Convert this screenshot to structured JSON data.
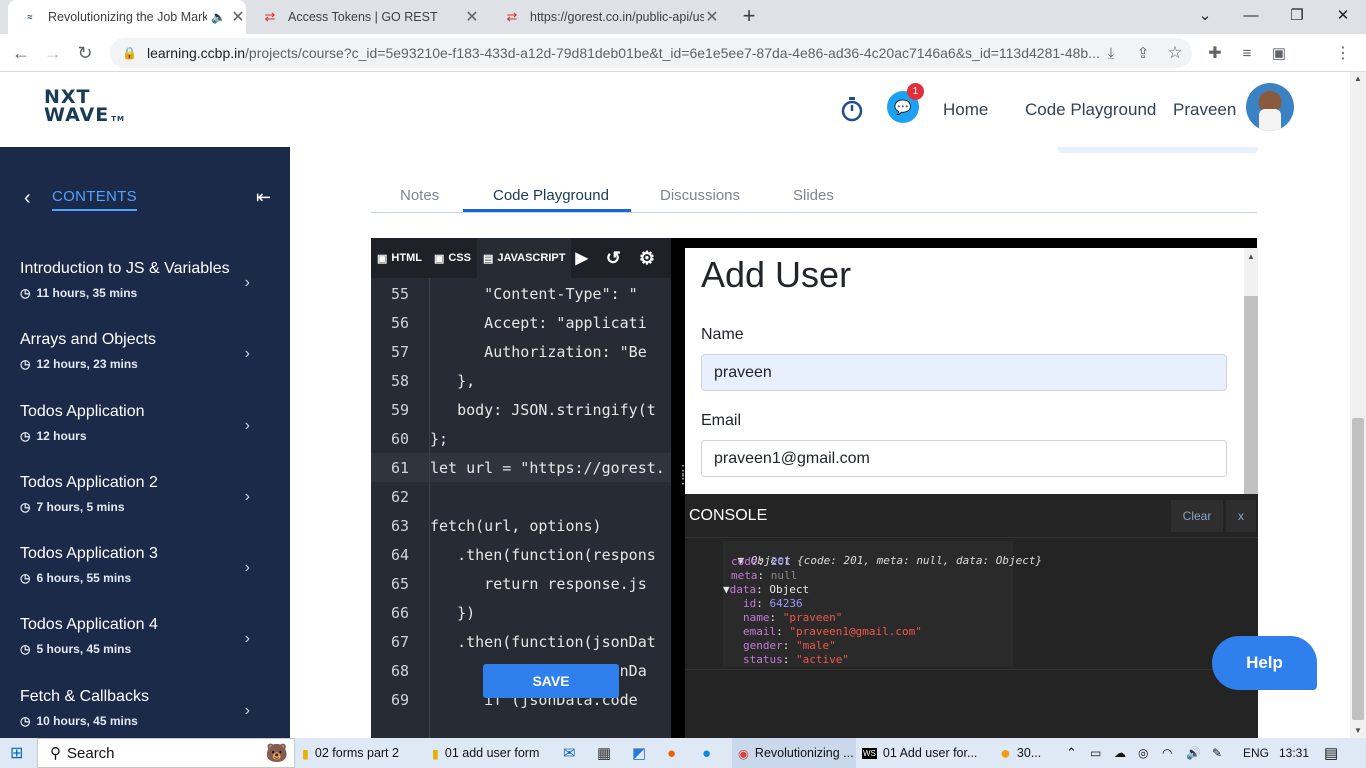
{
  "browser": {
    "tabs": [
      {
        "title": "Revolutionizing the Job Mark",
        "active": true
      },
      {
        "title": "Access Tokens | GO REST",
        "active": false
      },
      {
        "title": "https://gorest.co.in/public-api/us",
        "active": false
      }
    ],
    "new_tab": "+",
    "url_domain": "learning.ccbp.in",
    "url_path": "/projects/course?c_id=5e93210e-f183-433d-a12d-79d81deb01be&t_id=6e1e5ee7-87da-4e86-ad36-4c20ac7146a6&s_id=113d4281-48b..."
  },
  "header": {
    "logo_line1": "NXT",
    "logo_line2": "WAVE",
    "logo_tm": "TM",
    "notification_count": "1",
    "nav_home": "Home",
    "nav_code_playground": "Code Playground",
    "user_name": "Praveen"
  },
  "sidebar": {
    "title": "CONTENTS",
    "items": [
      {
        "title": "Introduction to JS & Variables",
        "duration": "11 hours, 35 mins"
      },
      {
        "title": "Arrays and Objects",
        "duration": "12 hours, 23 mins"
      },
      {
        "title": "Todos Application",
        "duration": "12 hours"
      },
      {
        "title": "Todos Application 2",
        "duration": "7 hours, 5 mins"
      },
      {
        "title": "Todos Application 3",
        "duration": "6 hours, 55 mins"
      },
      {
        "title": "Todos Application 4",
        "duration": "5 hours, 45 mins"
      },
      {
        "title": "Fetch & Callbacks",
        "duration": "10 hours, 45 mins"
      }
    ]
  },
  "content_tabs": [
    "Notes",
    "Code Playground",
    "Discussions",
    "Slides"
  ],
  "editor": {
    "tabs": [
      "HTML",
      "CSS",
      "JAVASCRIPT"
    ],
    "lines": [
      {
        "n": "55",
        "text": "      \"Content-Type\": \""
      },
      {
        "n": "56",
        "text": "      Accept: \"applicati"
      },
      {
        "n": "57",
        "text": "      Authorization: \"Be"
      },
      {
        "n": "58",
        "text": "   },"
      },
      {
        "n": "59",
        "text": "   body: JSON.stringify(t"
      },
      {
        "n": "60",
        "text": "};"
      },
      {
        "n": "61",
        "text": "let url = \"https://gorest."
      },
      {
        "n": "62",
        "text": ""
      },
      {
        "n": "63",
        "text": "fetch(url, options)"
      },
      {
        "n": "64",
        "text": "   .then(function(respons"
      },
      {
        "n": "65",
        "text": "      return response.js"
      },
      {
        "n": "66",
        "text": "   })"
      },
      {
        "n": "67",
        "text": "   .then(function(jsonDat"
      },
      {
        "n": "68",
        "text": "      console.log(jsonDa"
      },
      {
        "n": "69",
        "text": "      if (jsonData.code"
      }
    ],
    "save_label": "SAVE"
  },
  "preview": {
    "heading": "Add User",
    "name_label": "Name",
    "name_value": "praveen",
    "email_label": "Email",
    "email_value": "praveen1@gmail.com"
  },
  "console": {
    "title": "CONSOLE",
    "clear_label": "Clear",
    "close_label": "x",
    "summary": "Object {code: 201, meta: null, data: Object}",
    "entries": [
      {
        "key": "code",
        "value": "201"
      },
      {
        "key": "meta",
        "value": "null"
      },
      {
        "key": "data",
        "value": "Object"
      },
      {
        "key": "id",
        "value": "64236"
      },
      {
        "key": "name",
        "value": "\"praveen\""
      },
      {
        "key": "email",
        "value": "\"praveen1@gmail.com\""
      },
      {
        "key": "gender",
        "value": "\"male\""
      },
      {
        "key": "status",
        "value": "\"active\""
      }
    ]
  },
  "help_label": "Help",
  "taskbar": {
    "search": "Search",
    "items": [
      "02 forms part 2",
      "01 add user form",
      "Revolutionizing ...",
      "01 Add user for..."
    ],
    "weather": "30...",
    "lang": "ENG",
    "time": "13:31"
  }
}
